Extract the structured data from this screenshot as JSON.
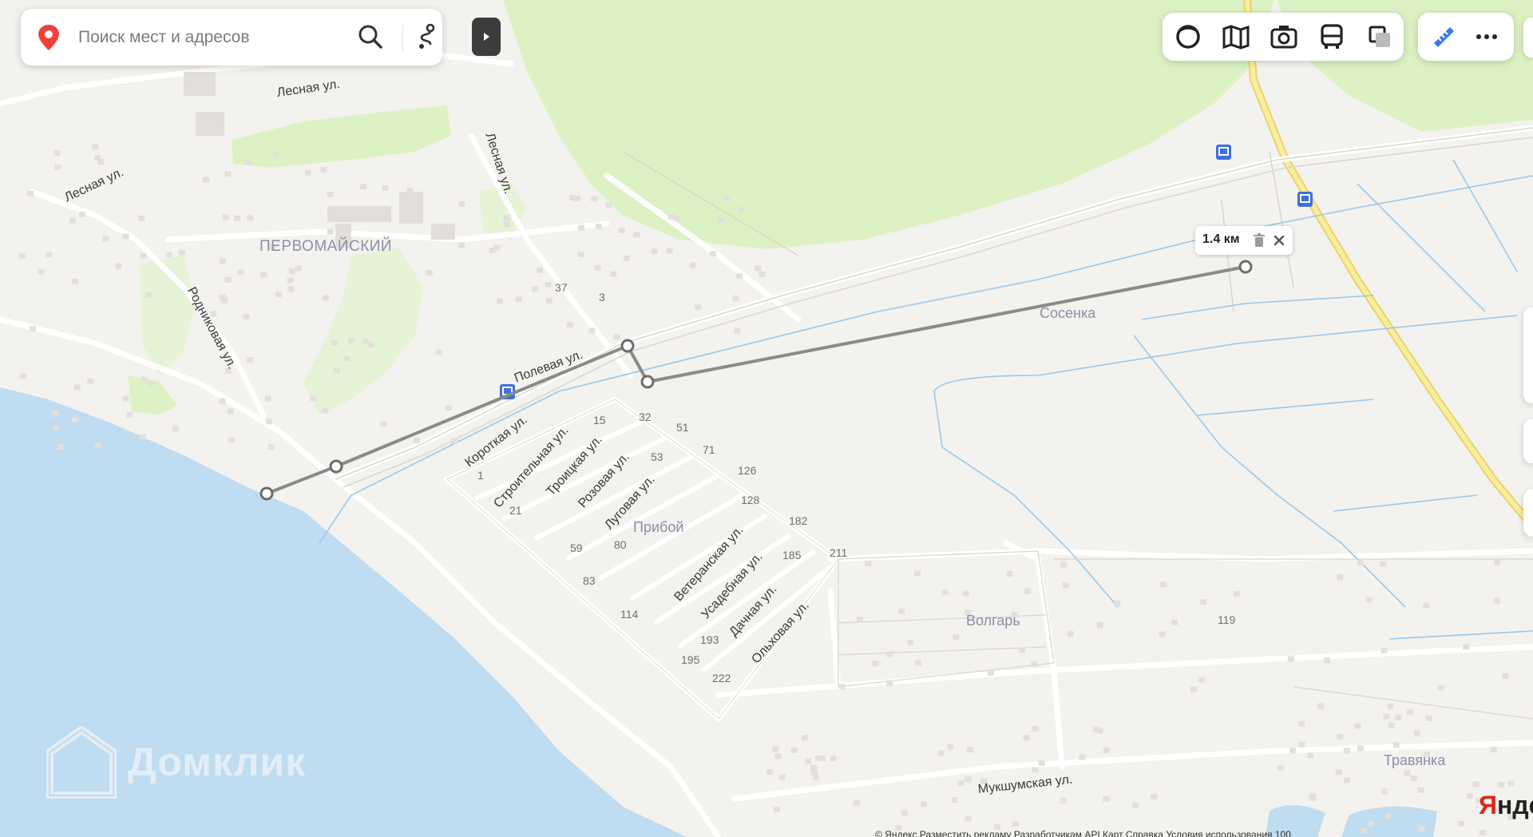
{
  "search": {
    "placeholder": "Поиск мест и адресов"
  },
  "icons": {
    "pin": "location-pin-icon",
    "search": "search-icon",
    "route": "route-icon",
    "collapse": "play-arrow-icon",
    "layers": [
      "panorama-icon",
      "map-layers-icon",
      "photo-camera-icon",
      "public-transport-icon",
      "satellite-icon"
    ],
    "tools": [
      "ruler-icon",
      "more-icon"
    ]
  },
  "ruler": {
    "distance": "1.4 км"
  },
  "places": {
    "pervomaysky": "ПЕРВОМАЙСКИЙ",
    "sosenka": "Сосенка",
    "priboy": "Прибой",
    "volgar": "Волгарь",
    "travyanka": "Травянка"
  },
  "streets": {
    "lesnaya_1": "Лесная ул.",
    "lesnaya_2": "Лесная ул.",
    "lesnaya_3": "Лесная ул.",
    "rodnikovaya": "Родниковая ул.",
    "polevaya": "Полевая ул.",
    "korotkaya": "Короткая ул.",
    "stroitelnaya": "Строительная ул.",
    "troitskaya": "Троицкая ул.",
    "rozovaya": "Розовая ул.",
    "lugovaya": "Луговая ул.",
    "veteranskaya": "Ветеранская ул.",
    "usadebnaya": "Усадебная ул.",
    "dachnaya": "Дачная ул.",
    "olkhovaya": "Ольховая ул.",
    "mukshumskaya": "Мукшумская ул."
  },
  "houses": {
    "h37": "37",
    "h3": "3",
    "h15": "15",
    "h32": "32",
    "h51": "51",
    "h71": "71",
    "h53": "53",
    "h126": "126",
    "h128": "128",
    "h182": "182",
    "h185": "185",
    "h211": "211",
    "h1": "1",
    "h21": "21",
    "h59": "59",
    "h80": "80",
    "h83": "83",
    "h114": "114",
    "h193": "193",
    "h195": "195",
    "h222": "222",
    "h119": "119"
  },
  "watermark": "Домклик",
  "brand": {
    "first": "Я",
    "rest": "нде"
  },
  "footer": "© Яндекс   Разместить рекламу   Разработчикам   API Карт   Справка   Условия использования   100"
}
